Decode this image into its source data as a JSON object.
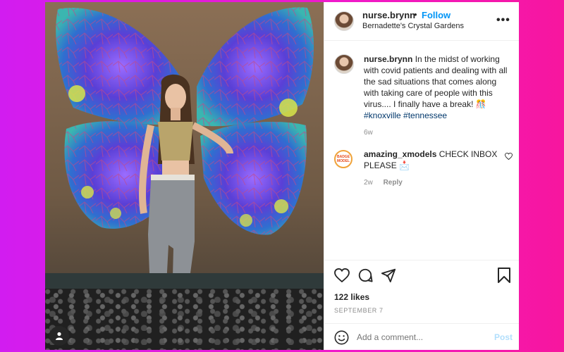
{
  "post": {
    "username": "nurse.brynn",
    "follow_label": "Follow",
    "separator": "•",
    "location": "Bernadette's Crystal Gardens",
    "more_label": "•••"
  },
  "caption": {
    "username": "nurse.brynn",
    "text": " In the midst of working with covid patients and dealing with all the sad situations that comes along with taking care of people with this virus.... I finally have a break! 🎊",
    "hashtag1": "#knoxville",
    "hashtag2": "#tennessee",
    "time": "6w"
  },
  "comment": {
    "username": "amazing_xmodels",
    "text": " CHECK INBOX PLEASE 📩",
    "time": "2w",
    "reply_label": "Reply",
    "badge_text": "BADGE MODEL"
  },
  "actions": {
    "likes": "122 likes",
    "date": "SEPTEMBER 7"
  },
  "add_comment": {
    "placeholder": "Add a comment...",
    "post_label": "Post"
  },
  "colors": {
    "link_blue": "#0095f6",
    "hashtag": "#00376b",
    "muted": "#8e8e8e",
    "post_disabled": "#b2dffc"
  }
}
